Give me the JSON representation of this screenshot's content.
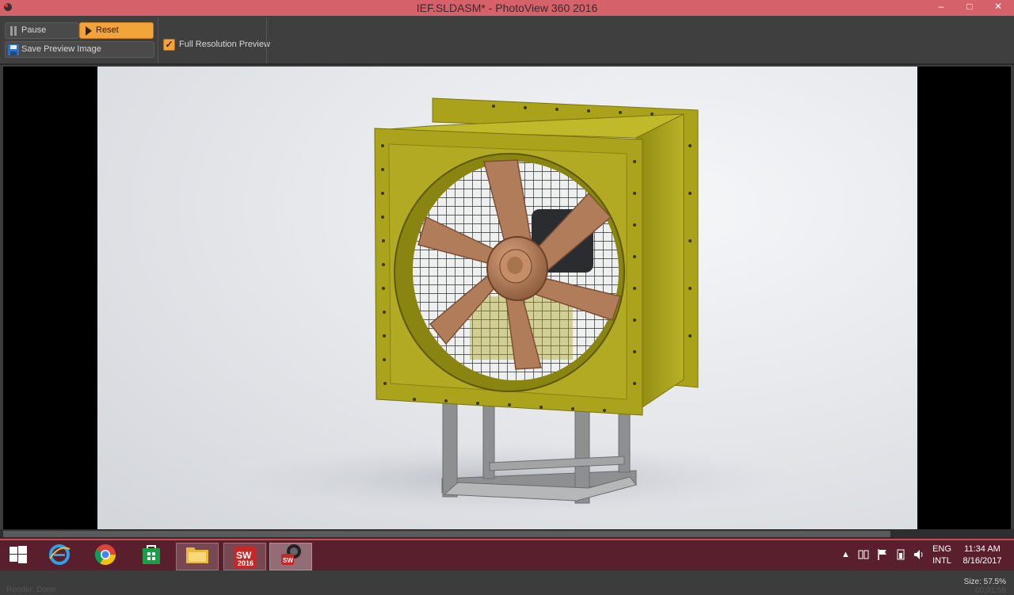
{
  "window": {
    "title": "IEF.SLDASM* - PhotoView 360 2016",
    "minimize": "–",
    "maximize": "□",
    "close": "✕"
  },
  "toolbar": {
    "pause_label": "Pause",
    "reset_label": "Reset",
    "save_preview_label": "Save Preview Image",
    "full_res_label": "Full Resolution Preview",
    "full_res_checked": true
  },
  "render": {
    "status": "Render: Done",
    "size": "Size: 57.5%",
    "elapsed": "00:01:58"
  },
  "taskbar": {
    "solidworks_badge": "2016",
    "lang_line1": "ENG",
    "lang_line2": "INTL",
    "time": "11:34 AM",
    "date": "8/16/2017"
  },
  "colors": {
    "titlebar": "#d5616a",
    "accent_orange": "#f2a33a",
    "fan_housing": "#a8a016",
    "fan_blade": "#b07c5a",
    "taskbar": "#5a1f2c"
  }
}
